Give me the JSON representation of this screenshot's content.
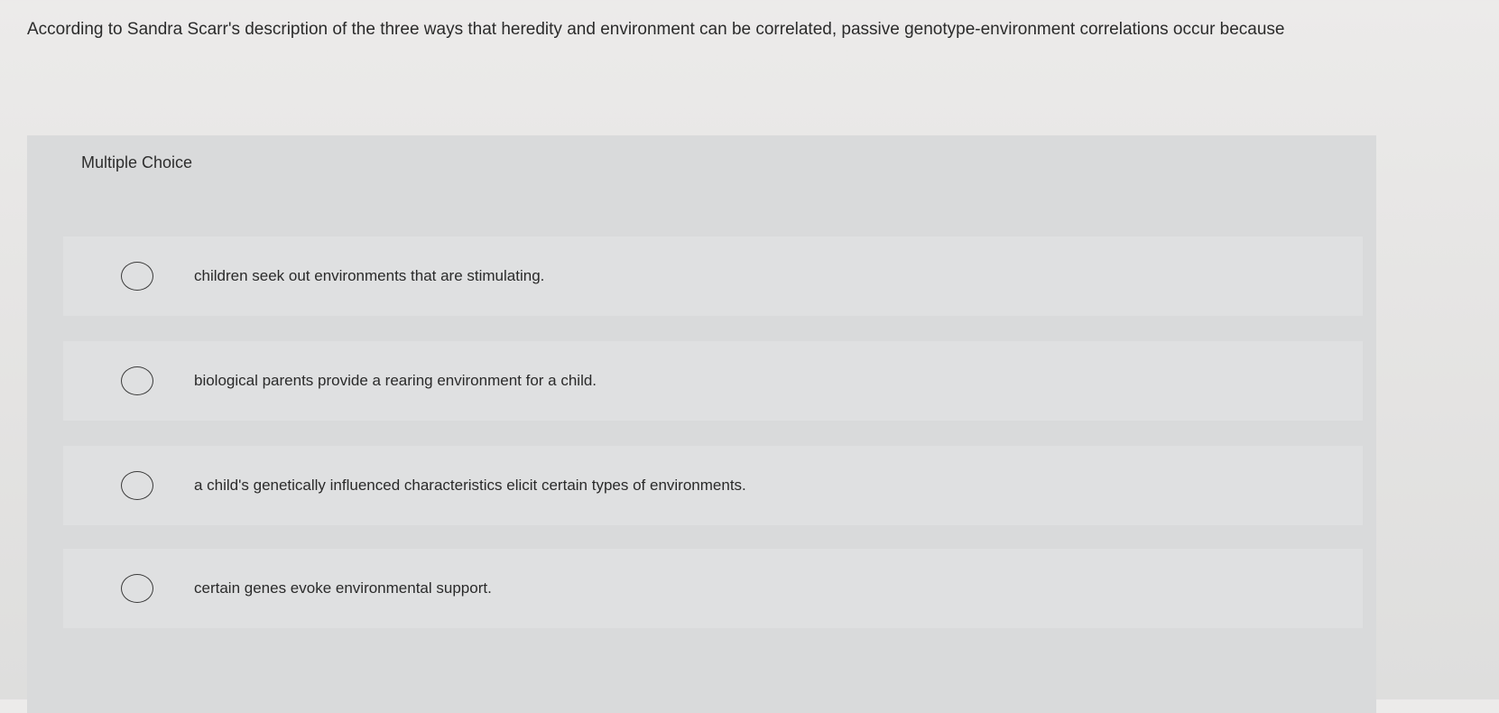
{
  "question": {
    "text": "According to Sandra Scarr's description of the three ways that heredity and environment can be correlated, passive genotype-environment correlations occur because"
  },
  "card": {
    "type_label": "Multiple Choice",
    "options": [
      {
        "label": "children seek out environments that are stimulating."
      },
      {
        "label": "biological parents provide a rearing environment for a child."
      },
      {
        "label": "a child's genetically influenced characteristics elicit certain types of environments."
      },
      {
        "label": "certain genes evoke environmental support."
      }
    ]
  }
}
